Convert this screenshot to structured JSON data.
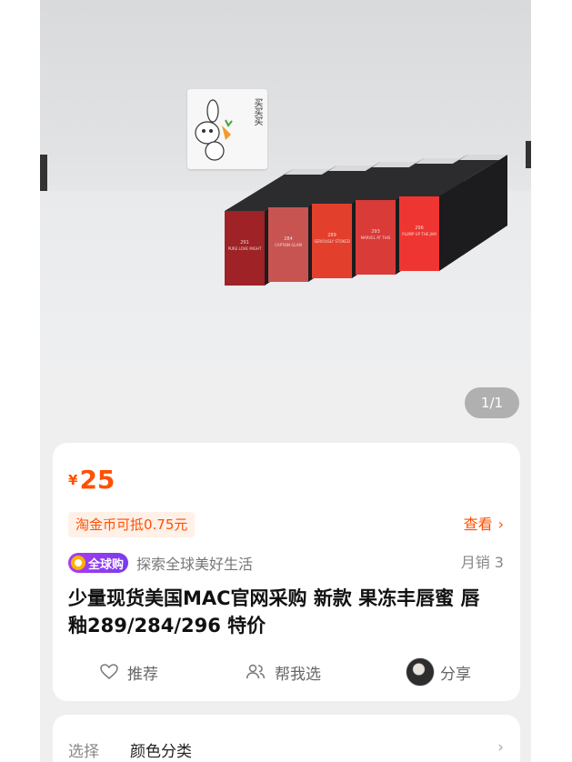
{
  "gallery": {
    "counter": "1/1",
    "photo_card_text": "买买买",
    "shades": [
      {
        "number": "291",
        "name": "PURE LOVE MIGHT",
        "color": "#9e2226"
      },
      {
        "number": "284",
        "name": "CAPTAIN GLAM",
        "color": "#c85452"
      },
      {
        "number": "289",
        "name": "SERIOUSLY STOKED",
        "color": "#e2402c"
      },
      {
        "number": "293",
        "name": "MARVEL AT THIS",
        "color": "#d93b38"
      },
      {
        "number": "296",
        "name": "PLUMP UP THE JAM",
        "color": "#ee3532"
      }
    ]
  },
  "product": {
    "currency": "¥",
    "price": "25",
    "coupon_text": "淘金币可抵0.75元",
    "view_label": "查看",
    "badge_label": "全球购",
    "slogan": "探索全球美好生活",
    "sales": "月销 3",
    "title": "少量现货美国MAC官网采购 新款 果冻丰唇蜜 唇釉289/284/296 特价"
  },
  "actions": {
    "recommend_label": "推荐",
    "choose_label": "帮我选",
    "share_label": "分享"
  },
  "select": {
    "label": "选择",
    "value": "颜色分类"
  },
  "colors": {
    "accent": "#ff5000",
    "badge": "#8b3cf0"
  }
}
